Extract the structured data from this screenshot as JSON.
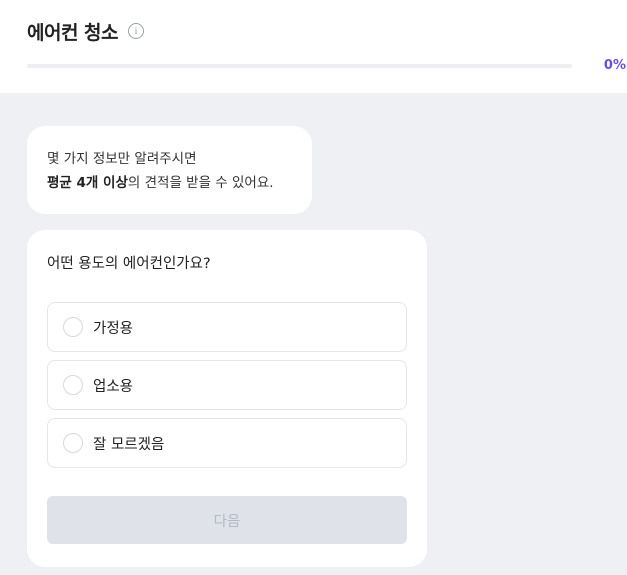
{
  "header": {
    "title": "에어컨 청소",
    "info_icon": "info-icon",
    "progress_percent": 0,
    "progress_text": "0%",
    "accent_color": "#6b4ee0"
  },
  "intro": {
    "line1": "몇 가지 정보만 알려주시면",
    "line2_bold": "평균 4개 이상",
    "line2_rest": "의 견적을 받을 수 있어요."
  },
  "question": {
    "text": "어떤 용도의 에어컨인가요?",
    "options": [
      {
        "label": "가정용"
      },
      {
        "label": "업소용"
      },
      {
        "label": "잘 모르겠음"
      }
    ]
  },
  "next_button": {
    "label": "다음",
    "disabled": true
  }
}
